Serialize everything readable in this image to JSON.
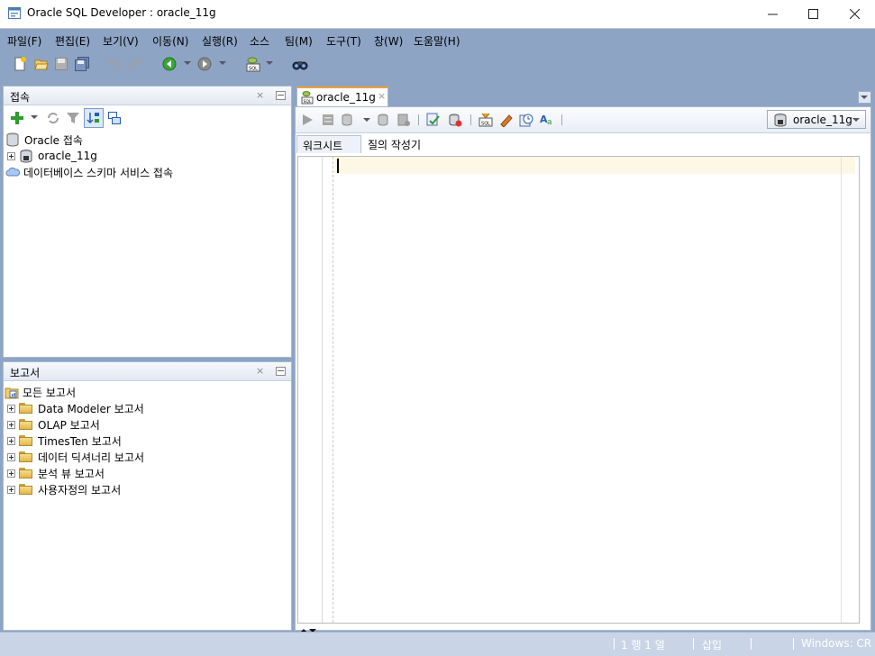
{
  "window": {
    "title": "Oracle SQL Developer : oracle_11g",
    "controls": [
      "minimize",
      "maximize",
      "close"
    ]
  },
  "menu": [
    {
      "label": "파일(F)"
    },
    {
      "label": "편집(E)"
    },
    {
      "label": "보기(V)"
    },
    {
      "label": "이동(N)"
    },
    {
      "label": "실행(R)"
    },
    {
      "label": "소스"
    },
    {
      "label": "팀(M)"
    },
    {
      "label": "도구(T)"
    },
    {
      "label": "창(W)"
    },
    {
      "label": "도움말(H)"
    }
  ],
  "toolbar": {
    "icons": [
      "new-icon",
      "open-icon",
      "save-icon",
      "save-all-icon",
      "undo-icon",
      "redo-icon",
      "back-icon",
      "forward-icon",
      "sql-worksheet-icon",
      "binoculars-icon"
    ]
  },
  "connections_panel": {
    "title": "접속",
    "tree": [
      {
        "label": "Oracle 접속"
      },
      {
        "label": "oracle_11g"
      },
      {
        "label": "데이터베이스 스키마 서비스 접속"
      }
    ]
  },
  "reports_panel": {
    "title": "보고서",
    "tree": [
      {
        "label": "모든 보고서"
      },
      {
        "label": "Data Modeler 보고서"
      },
      {
        "label": "OLAP 보고서"
      },
      {
        "label": "TimesTen 보고서"
      },
      {
        "label": "데이터 딕셔너리 보고서"
      },
      {
        "label": "분석 뷰 보고서"
      },
      {
        "label": "사용자정의 보고서"
      }
    ]
  },
  "editor": {
    "tab_label": "oracle_11g",
    "connection_selector": "oracle_11g",
    "subtabs": [
      "워크시트",
      "질의 작성기"
    ],
    "content": ""
  },
  "statusbar": {
    "position": "1 행 1 열",
    "mode": "삽입",
    "line_ending": "Windows: CR"
  },
  "colors": {
    "frame": "#8da4c4",
    "accent_tab": "#f0a030",
    "current_line": "#fdf8e6"
  }
}
